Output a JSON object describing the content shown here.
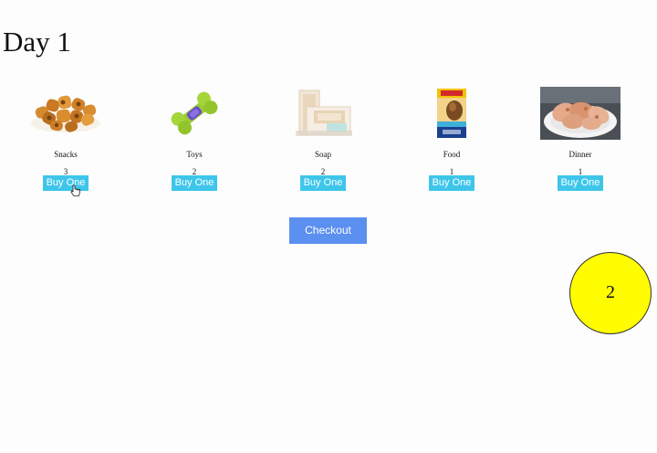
{
  "page": {
    "title": "Day 1"
  },
  "items": [
    {
      "name": "Snacks",
      "count": "3",
      "button_label": "Buy One",
      "image": "snacks-image"
    },
    {
      "name": "Toys",
      "count": "2",
      "button_label": "Buy One",
      "image": "dog-toy-image"
    },
    {
      "name": "Soap",
      "count": "2",
      "button_label": "Buy One",
      "image": "soap-image"
    },
    {
      "name": "Food",
      "count": "1",
      "button_label": "Buy One",
      "image": "dog-food-bag-image"
    },
    {
      "name": "Dinner",
      "count": "1",
      "button_label": "Buy One",
      "image": "dinner-plate-image"
    }
  ],
  "checkout": {
    "label": "Checkout"
  },
  "badge": {
    "value": "2"
  },
  "colors": {
    "buy_button": "#3ec6ea",
    "checkout_button": "#5b8ff0",
    "badge_fill": "#fffd00"
  }
}
